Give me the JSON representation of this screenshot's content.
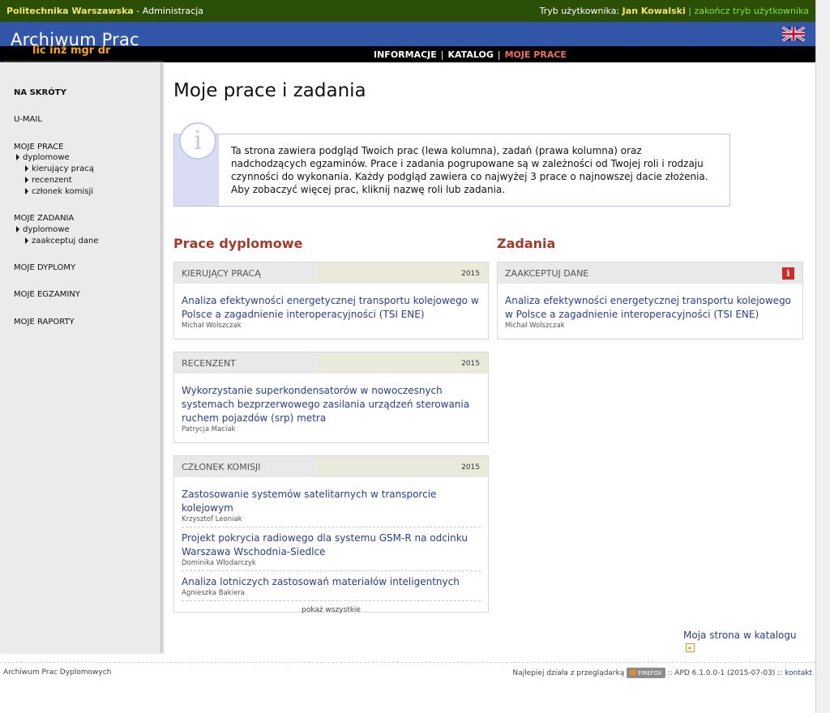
{
  "topbar": {
    "university": "Politechnika Warszawska",
    "section": " - Administracja",
    "mode_label": "Tryb użytkownika: ",
    "user": "Jan Kowalski",
    "separator": " | ",
    "end_mode": "zakończ tryb użytkownika"
  },
  "header": {
    "logo": "Archiwum Prac",
    "sublogo": "lic inż mgr dr",
    "nav": [
      "INFORMACJE",
      "KATALOG",
      "MOJE PRACE"
    ],
    "nav_sep": "|",
    "language_icon": "uk-flag-icon"
  },
  "sidebar": {
    "shortcuts": "NA SKRÓTY",
    "umail": "U-MAIL",
    "my_works": "MOJE PRACE",
    "my_works_sub": "dyplomowe",
    "my_works_subsub": [
      "kierujący pracą",
      "recenzent",
      "członek komisji"
    ],
    "my_tasks": "MOJE ZADANIA",
    "my_tasks_sub": "dyplomowe",
    "my_tasks_subsub": [
      "zaakceptuj dane"
    ],
    "my_diplomas": "MOJE DYPLOMY",
    "my_exams": "MOJE EGZAMINY",
    "my_reports": "MOJE RAPORTY"
  },
  "main": {
    "title": "Moje prace i zadania",
    "info_icon": "i",
    "info_text": "Ta strona zawiera podgląd Twoich prac (lewa kolumna), zadań (prawa kolumna) oraz nadchodzących egzaminów. Prace i zadania pogrupowane są w zależności od Twojej roli i rodzaju czynności do wykonania. Każdy podgląd zawiera co najwyżej 3 prace o najnowszej dacie złożenia. Aby zobaczyć więcej prac, kliknij nazwę roli lub zadania.",
    "theses_title": "Prace dyplomowe",
    "tasks_title": "Zadania",
    "supervisor": {
      "role": "KIERUJĄCY PRACĄ",
      "year": "2015",
      "entries": [
        {
          "title": "Analiza efektywności energetycznej transportu kolejowego w Polsce a zagadnienie interoperacyjności (TSI ENE)",
          "author": "Michał Wolszczak"
        }
      ]
    },
    "reviewer": {
      "role": "RECENZENT",
      "year": "2015",
      "entries": [
        {
          "title": "Wykorzystanie superkondensatorów w nowoczesnych systemach bezprzerwowego zasilania urządzeń sterowania ruchem pojazdów (srp) metra",
          "author": "Patrycja Maciak"
        }
      ]
    },
    "committee": {
      "role": "CZŁONEK KOMISJI",
      "year": "2015",
      "entries": [
        {
          "title": "Zastosowanie systemów satelitarnych w transporcie kolejowym",
          "author": "Krzysztof Leoniak"
        },
        {
          "title": "Projekt pokrycia radiowego dla systemu GSM-R na odcinku Warszawa Wschodnia-Siedlce",
          "author": "Dominika Włodarczyk"
        },
        {
          "title": "Analiza lotniczych zastosowań materiałów inteligentnych",
          "author": "Agnieszka Bakiera"
        }
      ],
      "show_all": "pokaż wszystkie"
    },
    "accept_data": {
      "role": "ZAAKCEPTUJ DANE",
      "alert_icon": "i",
      "entries": [
        {
          "title": "Analiza efektywności energetycznej transportu kolejowego w Polsce a zagadnienie interoperacyjności (TSI ENE)",
          "author": "Michał Wolszczak"
        }
      ]
    },
    "my_page_link": "Moja strona w katalogu"
  },
  "footer": {
    "left": "Archiwum Prac Dyplomowych",
    "best_with": "Najlepiej działa z przeglądarką",
    "browser": "FIREFOX",
    "version": " :: APD 6.1.0.0-1 (2015-07-03) :: ",
    "contact": "kontakt"
  }
}
